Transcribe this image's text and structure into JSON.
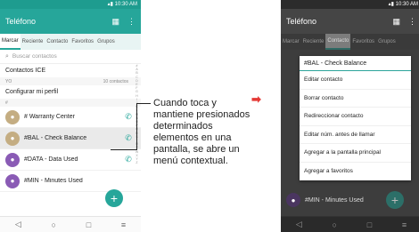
{
  "phone1": {
    "status": {
      "time": "10:30 AM"
    },
    "appbar": {
      "title": "Teléfono"
    },
    "tabs": [
      "Marcar",
      "Reciente",
      "Contacto",
      "Favoritos",
      "Grupos"
    ],
    "search_placeholder": "Buscar contactos",
    "ice_label": "Contactos ICE",
    "section_yo": "YO",
    "section_yo_count": "10 contactos",
    "profile_label": "Configurar mi perfil",
    "section_hash": "#",
    "contacts": [
      "# Warranty Center",
      "#BAL - Check Balance",
      "#DATA - Data Used",
      "#MIN - Minutes Used"
    ],
    "alphabet": [
      "#",
      "A",
      "B",
      "C",
      "D",
      "E",
      "F",
      "G",
      "H",
      "I",
      "J",
      "K",
      "L",
      "M",
      "N",
      "O",
      "P",
      "Q",
      "R",
      "S",
      "T",
      "U",
      "V",
      "W",
      "X",
      "Y",
      "Z"
    ]
  },
  "annotation": {
    "text": "Cuando toca y mantiene presionados determinados elementos en una pantalla, se abre un menú contextual."
  },
  "phone2": {
    "status": {
      "time": "10:30 AM"
    },
    "appbar": {
      "title": "Teléfono"
    },
    "tabs": [
      "Marcar",
      "Reciente",
      "Contacto",
      "Favoritos",
      "Grupos"
    ],
    "visible_contact": "#MIN - Minutes Used",
    "menu": {
      "header": "#BAL - Check Balance",
      "items": [
        "Editar contacto",
        "Borrar contacto",
        "Redireccionar contacto",
        "Editar núm. antes de llamar",
        "Agregar a la pantalla principal",
        "Agregar a favoritos"
      ]
    }
  },
  "colors": {
    "accent": "#26a69a",
    "arrow": "#e53935"
  },
  "icons": {
    "fab": "+",
    "call": "phone-icon",
    "person": "person-icon"
  }
}
